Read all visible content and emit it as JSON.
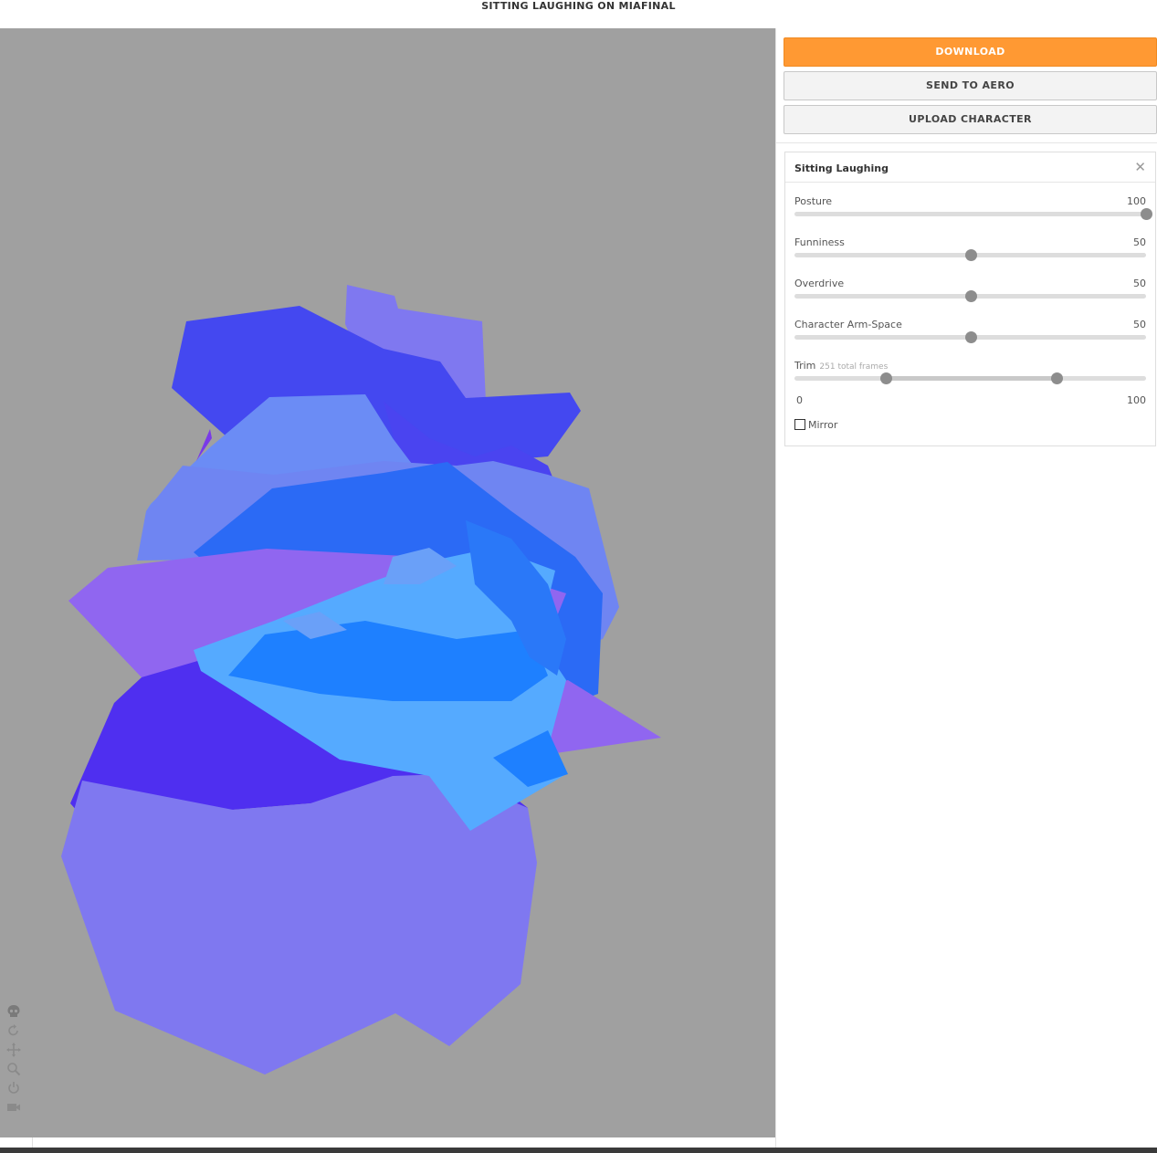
{
  "header": {
    "title": "SITTING LAUGHING ON MIAFINAL"
  },
  "viewport": {
    "background": "#a0a0a0",
    "palette": [
      "#4448f0",
      "#7a7ef0",
      "#6b8cf5",
      "#2b6af5",
      "#9066f0",
      "#4f2ff0",
      "#7f78f0",
      "#55aaff",
      "#1e80ff"
    ],
    "tools": [
      "skull-icon",
      "rotate-icon",
      "move-icon",
      "zoom-icon",
      "power-icon",
      "camera-icon"
    ]
  },
  "actions": {
    "download": "DOWNLOAD",
    "send_to_aero": "SEND TO AERO",
    "upload_character": "UPLOAD CHARACTER",
    "accent": "#ff9933"
  },
  "animation": {
    "title": "Sitting Laughing",
    "close": "✕",
    "posture": {
      "label": "Posture",
      "value": "100",
      "level": 1.0
    },
    "funniness": {
      "label": "Funniness",
      "value": "50",
      "level": 0.5
    },
    "overdrive": {
      "label": "Overdrive",
      "value": "50",
      "level": 0.5
    },
    "arm_space": {
      "label": "Character Arm-Space",
      "value": "50",
      "level": 0.5
    },
    "trim": {
      "label": "Trim",
      "frames": "251 total frames",
      "start": 0.26,
      "end": 0.745,
      "min_label": "0",
      "max_label": "100"
    },
    "mirror": {
      "label": "Mirror",
      "checked": false
    }
  }
}
